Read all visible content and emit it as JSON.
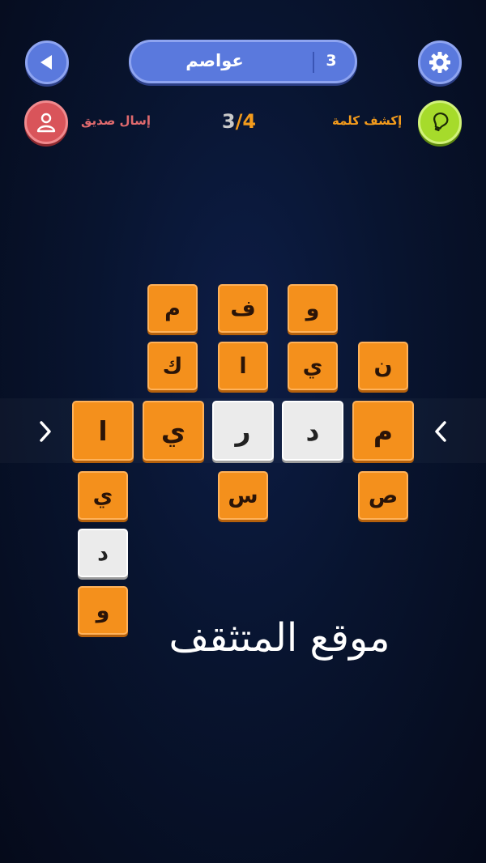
{
  "header": {
    "level_title": "عواصم",
    "level_number": "3"
  },
  "actions": {
    "friend_label": "إسال صديق",
    "hint_label": "إكشف كلمة"
  },
  "progress": {
    "current": "4",
    "separator": "/",
    "total": "3"
  },
  "board": {
    "row1": [
      "م",
      "ف",
      "و"
    ],
    "row2": [
      "ك",
      "ا",
      "ي",
      "ن"
    ],
    "row3": [
      "ا",
      "ي",
      "ر",
      "د",
      "م"
    ],
    "row4": [
      "ي",
      "س",
      "ص"
    ],
    "row5": [
      "د"
    ],
    "row6": [
      "و"
    ]
  },
  "watermark": "موقع المتثقف",
  "colors": {
    "accent_blue": "#5a79dd",
    "tile_orange": "#f4901c",
    "tile_white": "#ebebeb",
    "hint_green": "#a6db2b",
    "friend_red": "#d9545a"
  }
}
